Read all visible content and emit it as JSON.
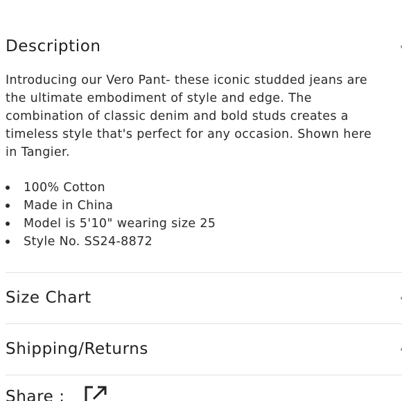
{
  "sections": {
    "description": {
      "title": "Description",
      "paragraph": "Introducing our Vero Pant- these iconic studded jeans are the ultimate embodiment of style and edge. The combination of classic denim and bold studs creates a timeless style that's perfect for any occasion. Shown here in Tangier.",
      "details": [
        "100% Cotton",
        "Made in China",
        "Model is 5'10\" wearing size 25",
        "Style No. SS24-8872"
      ]
    },
    "size_chart": {
      "title": "Size Chart"
    },
    "shipping_returns": {
      "title": "Shipping/Returns"
    }
  },
  "share": {
    "label": "Share :",
    "icon": "share-external-icon"
  }
}
